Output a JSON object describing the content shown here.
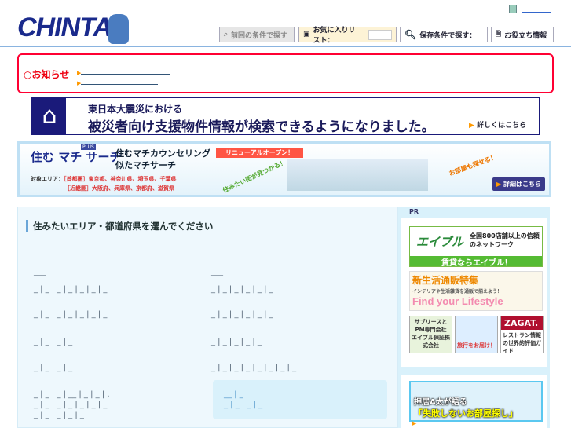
{
  "header": {
    "logo": "CHINTAI",
    "buttons": [
      "前回の条件で探す",
      "お気に入りリスト：",
      "保存条件で探す：",
      "お役立ち情報"
    ]
  },
  "notice": {
    "title": "お知らせ"
  },
  "quake": {
    "line1": "東日本大震災における",
    "line2": "被災者向け支援物件情報が検索できるようになりました。",
    "link": "詳しくはこちら"
  },
  "machi": {
    "logo": "住む マチ サーチ",
    "plus": "PLUS",
    "tag1": "住むマチカウンセリング",
    "tag2": "似たマチサーチ",
    "renewal": "リニューアルオープン！",
    "area_label": "対象エリア：",
    "area1": "［首都圏］東京都、神奈川県、埼玉県、千葉県",
    "area2": "［近畿圏］大阪府、兵庫県、京都府、滋賀県",
    "bubble1": "住みたい街が見つかる！",
    "bubble2": "お部屋も探せる！",
    "detail": "詳細はこちら"
  },
  "main": {
    "heading": "住みたいエリア・都道府県を選んでください"
  },
  "side": {
    "pr": "PR",
    "ad1_logo": "エイブル",
    "ad1_text": "全国800店舗以上の信頼のネットワーク",
    "ad1_foot": "賃貸ならエイブル！",
    "ad2_title": "新生活通販特集",
    "ad2_sub": "インテリアや生活雑貨を通販で揃えよう！",
    "ad2_big": "Find your Lifestyle",
    "ad3": "サブリースとPM専門会社 エイブル保証株式会社",
    "ad4": "旅行をお届け！",
    "ad5_logo": "ZAGAT.",
    "ad5": "レストラン情報の世界的評価ガイド",
    "ad6a": "押居A太が語る",
    "ad6b": "「失敗しないお部屋探し」"
  }
}
